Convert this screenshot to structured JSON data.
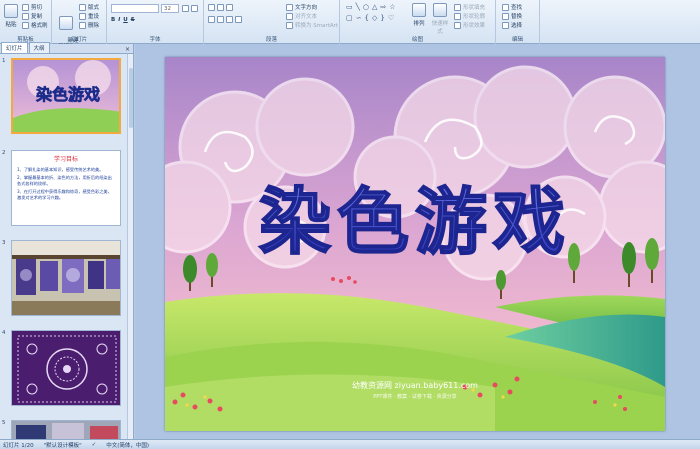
{
  "ribbon": {
    "clipboard": {
      "paste": "粘贴",
      "cut": "剪切",
      "copy": "复制",
      "format_painter": "格式刷",
      "label": "剪贴板"
    },
    "slides": {
      "new_slide": "新建\n幻灯片",
      "layout": "版式",
      "reset": "重设",
      "delete": "删除",
      "label": "幻灯片"
    },
    "font": {
      "size": "32",
      "label": "字体"
    },
    "paragraph": {
      "text_direction": "文字方向",
      "align_text": "对齐文本",
      "convert_smartart": "转换为 SmartArt",
      "label": "段落"
    },
    "drawing": {
      "arrange": "排列",
      "quick_styles": "快速样式",
      "shape_fill": "形状填充",
      "shape_outline": "形状轮廓",
      "shape_effects": "形状效果",
      "label": "绘图"
    },
    "editing": {
      "find": "查找",
      "replace": "替换",
      "select": "选择",
      "label": "编辑"
    }
  },
  "panel": {
    "tab_slides": "幻灯片",
    "tab_outline": "大纲",
    "close": "×",
    "thumbs": [
      {
        "num": "1",
        "title": "染色游戏"
      },
      {
        "num": "2",
        "heading": "学习目标",
        "lines": [
          "1、了解扎染的基本知识，感受传统艺术的美。",
          "2、掌握最基本的折、染色的方法，用折后的纸染出各式各样的纹样。",
          "3、在打开过程中获得乐趣和惊奇，感受色彩之美，激发对艺术的学习兴趣。"
        ]
      },
      {
        "num": "3"
      },
      {
        "num": "4"
      },
      {
        "num": "5"
      }
    ]
  },
  "slide": {
    "title": "染色游戏",
    "watermark_title": "幼教资源网 ziyuan.baby611.com",
    "watermark_sub": "PPT课件 · 教案 · 试卷下载 · 资源分享"
  },
  "status": {
    "slide_info": "幻灯片 1/20",
    "theme": "\"默认设计模板\"",
    "language": "中文(简体，中国)"
  }
}
